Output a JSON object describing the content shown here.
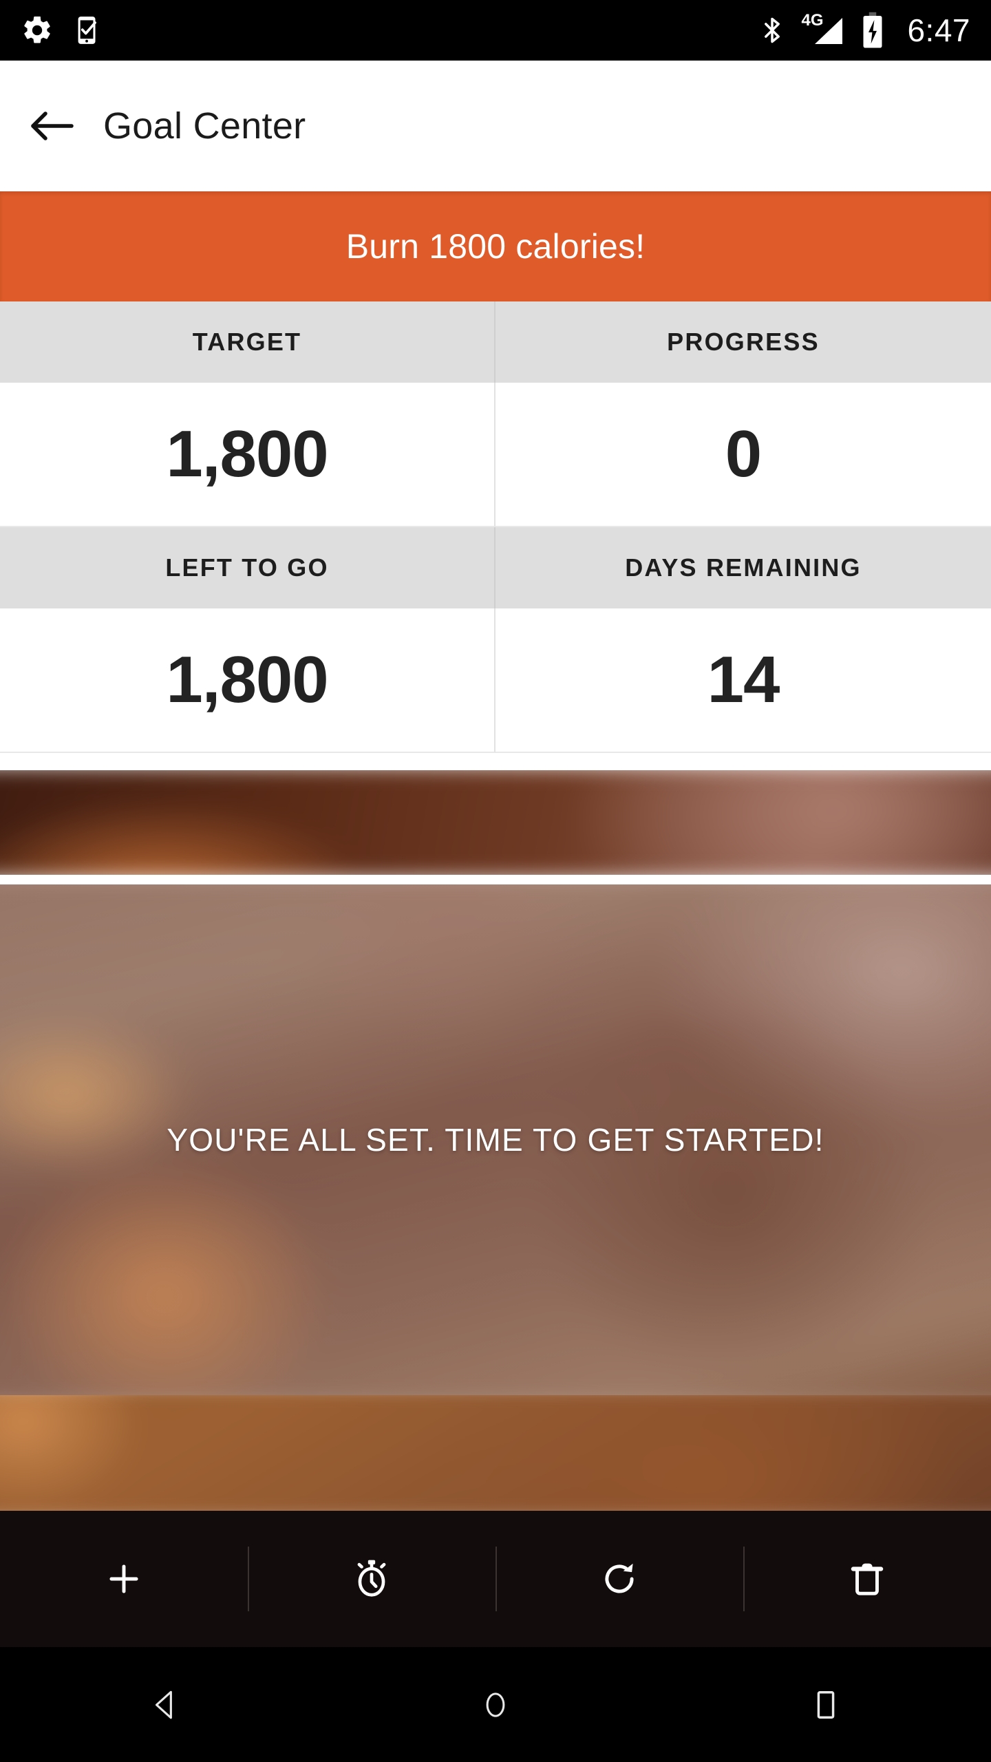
{
  "status_bar": {
    "icons_left": [
      "settings-gear-icon",
      "phone-checkmark-icon"
    ],
    "icons_right": [
      "bluetooth-icon",
      "signal-4g-icon",
      "battery-charging-icon"
    ],
    "network_label": "4G",
    "time": "6:47"
  },
  "app_bar": {
    "back_icon": "back-arrow-icon",
    "title": "Goal Center"
  },
  "banner": {
    "text": "Burn 1800 calories!",
    "color": "#df5b29"
  },
  "stats": {
    "rows": [
      {
        "cells": [
          {
            "label": "TARGET",
            "value": "1,800"
          },
          {
            "label": "PROGRESS",
            "value": "0"
          }
        ]
      },
      {
        "cells": [
          {
            "label": "LEFT TO GO",
            "value": "1,800"
          },
          {
            "label": "DAYS REMAINING",
            "value": "14"
          }
        ]
      }
    ],
    "label_bg": "#dedede",
    "value_bg": "#ffffff"
  },
  "photo": {
    "overlay_text": "YOU'RE ALL SET. TIME TO GET STARTED!",
    "description": "blurred warm-brown food photograph"
  },
  "toolbar": {
    "items": [
      {
        "icon": "plus-icon",
        "name": "add-entry-button"
      },
      {
        "icon": "stopwatch-icon",
        "name": "timer-button"
      },
      {
        "icon": "refresh-icon",
        "name": "reset-button"
      },
      {
        "icon": "trash-icon",
        "name": "delete-button"
      }
    ],
    "background": "#120d0c"
  },
  "nav_bar": {
    "items": [
      {
        "icon": "nav-back-icon",
        "name": "android-back-button"
      },
      {
        "icon": "nav-home-icon",
        "name": "android-home-button"
      },
      {
        "icon": "nav-recents-icon",
        "name": "android-recents-button"
      }
    ]
  }
}
